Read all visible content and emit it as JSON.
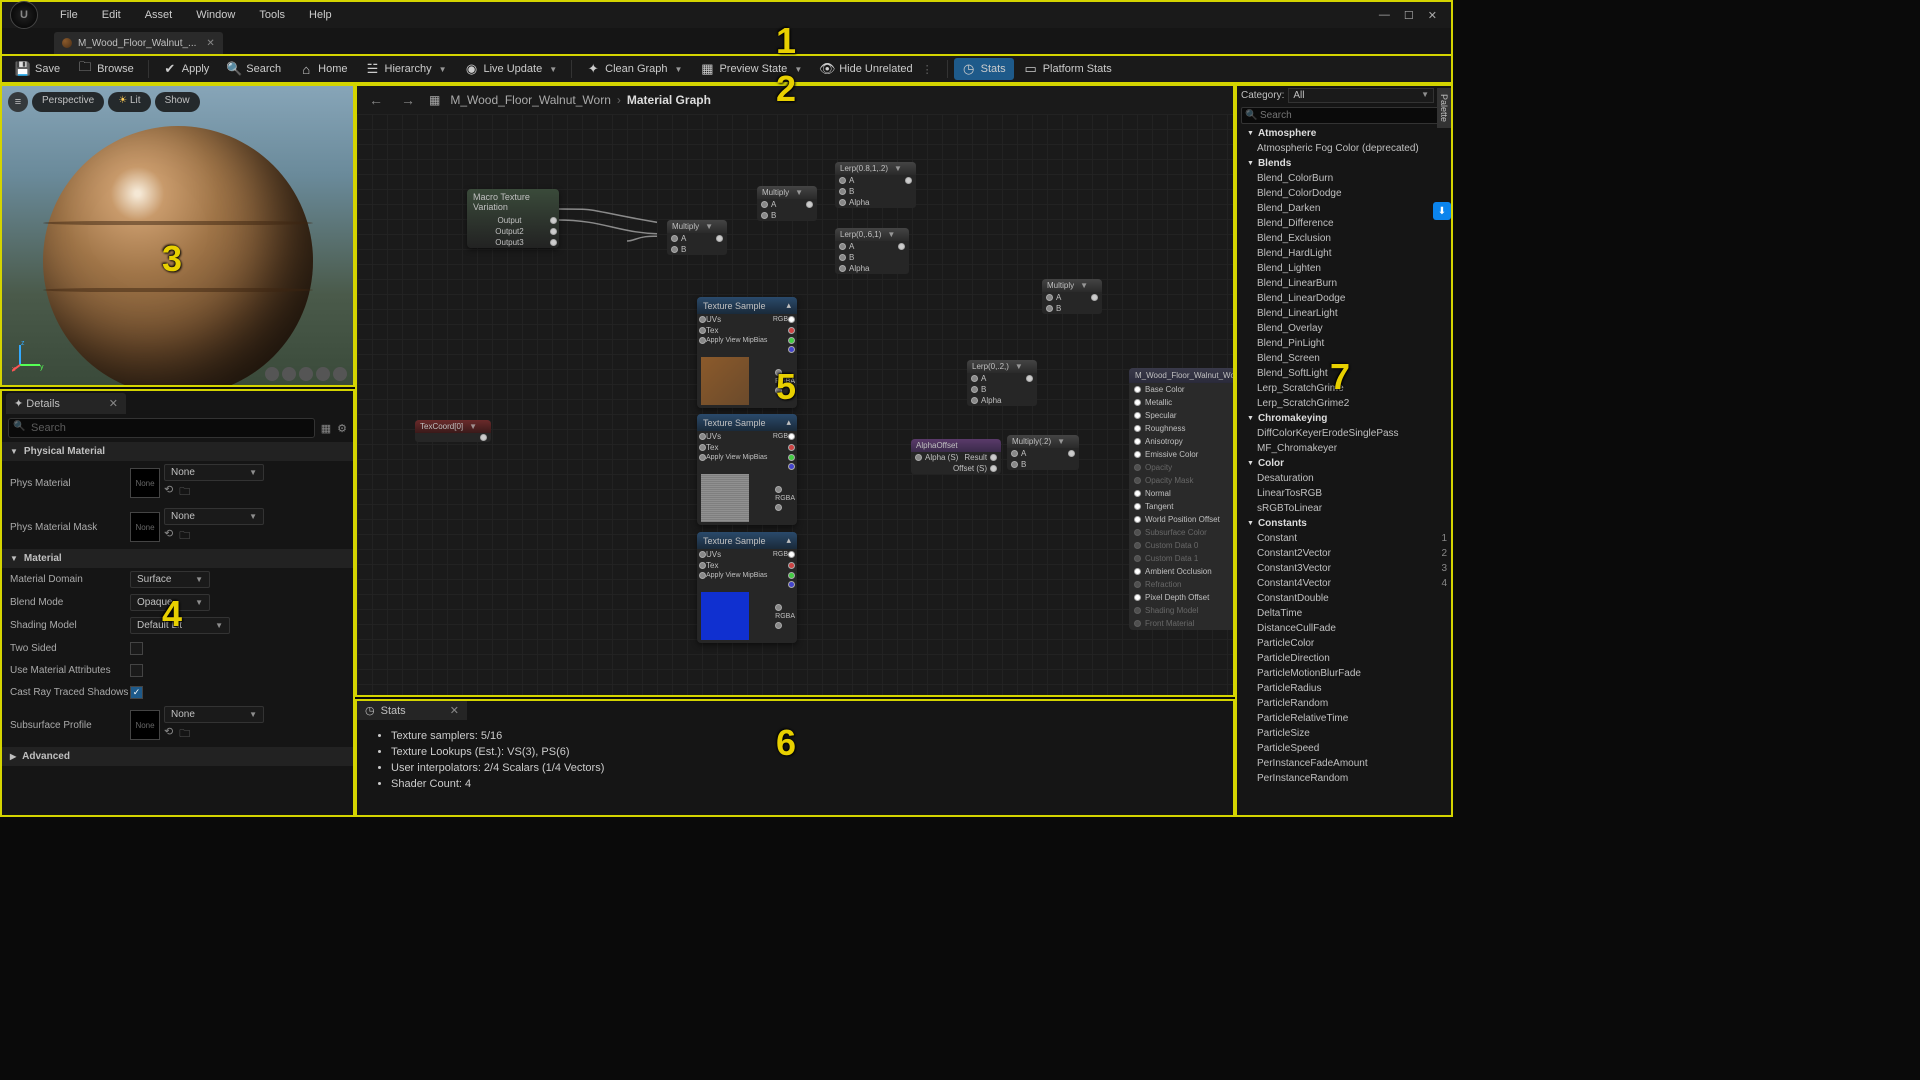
{
  "menubar": {
    "items": [
      "File",
      "Edit",
      "Asset",
      "Window",
      "Tools",
      "Help"
    ]
  },
  "tab": {
    "label": "M_Wood_Floor_Walnut_..."
  },
  "toolbar": {
    "save": "Save",
    "browse": "Browse",
    "apply": "Apply",
    "search": "Search",
    "home": "Home",
    "hierarchy": "Hierarchy",
    "live_update": "Live Update",
    "clean_graph": "Clean Graph",
    "preview_state": "Preview State",
    "hide_unrelated": "Hide Unrelated",
    "stats": "Stats",
    "platform_stats": "Platform Stats"
  },
  "viewport": {
    "perspective": "Perspective",
    "lit": "Lit",
    "show": "Show"
  },
  "details": {
    "tab_label": "Details",
    "search_placeholder": "Search",
    "sections": {
      "physical_material": "Physical Material",
      "material": "Material",
      "advanced": "Advanced"
    },
    "phys_material": {
      "label": "Phys Material",
      "thumb": "None",
      "dd": "None"
    },
    "phys_material_mask": {
      "label": "Phys Material Mask",
      "thumb": "None",
      "dd": "None"
    },
    "material_domain": {
      "label": "Material Domain",
      "value": "Surface"
    },
    "blend_mode": {
      "label": "Blend Mode",
      "value": "Opaque"
    },
    "shading_model": {
      "label": "Shading Model",
      "value": "Default Lit"
    },
    "two_sided": {
      "label": "Two Sided"
    },
    "use_material_attributes": {
      "label": "Use Material Attributes"
    },
    "cast_ray_traced": {
      "label": "Cast Ray Traced Shadows",
      "checked": true
    },
    "subsurface_profile": {
      "label": "Subsurface Profile",
      "thumb": "None",
      "dd": "None"
    }
  },
  "graph": {
    "breadcrumb_asset": "M_Wood_Floor_Walnut_Worn",
    "breadcrumb_current": "Material Graph",
    "nodes": {
      "macro": {
        "title": "Macro Texture Variation",
        "outputs": [
          "Output",
          "Output2",
          "Output3"
        ]
      },
      "multiply1": "Multiply",
      "multiply2": "Multiply",
      "multiply3": "Multiply",
      "multiply4": "Multiply(.2)",
      "lerp1": "Lerp(0.8,1,.2)",
      "lerp2": "Lerp(0,.6,1)",
      "lerp3": "Lerp(0,.2,)",
      "texcoord": "TexCoord[0]",
      "alpha_offset": "AlphaOffset",
      "ts1": "Texture Sample",
      "ts2": "Texture Sample",
      "ts3": "Texture Sample",
      "ts_pins": [
        "UVs",
        "Tex",
        "Apply View MipBias"
      ],
      "ts_outs": [
        "RGB",
        "R",
        "G",
        "B",
        "A",
        "RGBA"
      ],
      "lerp_pins": [
        "A",
        "B",
        "Alpha"
      ],
      "ao_pins": {
        "in": "Alpha (S)",
        "out1": "Result",
        "out2": "Offset (S)"
      }
    },
    "result": {
      "title": "M_Wood_Floor_Walnut_Worn",
      "pins": [
        {
          "label": "Base Color",
          "active": true
        },
        {
          "label": "Metallic",
          "active": true
        },
        {
          "label": "Specular",
          "active": true
        },
        {
          "label": "Roughness",
          "active": true
        },
        {
          "label": "Anisotropy",
          "active": true
        },
        {
          "label": "Emissive Color",
          "active": true
        },
        {
          "label": "Opacity",
          "active": false
        },
        {
          "label": "Opacity Mask",
          "active": false
        },
        {
          "label": "Normal",
          "active": true
        },
        {
          "label": "Tangent",
          "active": true
        },
        {
          "label": "World Position Offset",
          "active": true
        },
        {
          "label": "Subsurface Color",
          "active": false
        },
        {
          "label": "Custom Data 0",
          "active": false
        },
        {
          "label": "Custom Data 1",
          "active": false
        },
        {
          "label": "Ambient Occlusion",
          "active": true
        },
        {
          "label": "Refraction",
          "active": false
        },
        {
          "label": "Pixel Depth Offset",
          "active": true
        },
        {
          "label": "Shading Model",
          "active": false
        },
        {
          "label": "Front Material",
          "active": false
        }
      ]
    }
  },
  "stats": {
    "tab_label": "Stats",
    "lines": [
      "Texture samplers: 5/16",
      "Texture Lookups (Est.): VS(3), PS(6)",
      "User interpolators: 2/4 Scalars (1/4 Vectors)",
      "Shader Count: 4"
    ]
  },
  "palette": {
    "category_label": "Category:",
    "category_value": "All",
    "search_placeholder": "Search",
    "tab_label": "Palette",
    "groups": [
      {
        "name": "Atmosphere",
        "items": [
          {
            "label": "Atmospheric Fog Color (deprecated)"
          }
        ]
      },
      {
        "name": "Blends",
        "items": [
          {
            "label": "Blend_ColorBurn"
          },
          {
            "label": "Blend_ColorDodge"
          },
          {
            "label": "Blend_Darken"
          },
          {
            "label": "Blend_Difference"
          },
          {
            "label": "Blend_Exclusion"
          },
          {
            "label": "Blend_HardLight"
          },
          {
            "label": "Blend_Lighten"
          },
          {
            "label": "Blend_LinearBurn"
          },
          {
            "label": "Blend_LinearDodge"
          },
          {
            "label": "Blend_LinearLight"
          },
          {
            "label": "Blend_Overlay"
          },
          {
            "label": "Blend_PinLight"
          },
          {
            "label": "Blend_Screen"
          },
          {
            "label": "Blend_SoftLight"
          },
          {
            "label": "Lerp_ScratchGrime"
          },
          {
            "label": "Lerp_ScratchGrime2"
          }
        ]
      },
      {
        "name": "Chromakeying",
        "items": [
          {
            "label": "DiffColorKeyerErodeSinglePass"
          },
          {
            "label": "MF_Chromakeyer"
          }
        ]
      },
      {
        "name": "Color",
        "items": [
          {
            "label": "Desaturation"
          },
          {
            "label": "LinearTosRGB"
          },
          {
            "label": "sRGBToLinear"
          }
        ]
      },
      {
        "name": "Constants",
        "items": [
          {
            "label": "Constant",
            "shortcut": "1"
          },
          {
            "label": "Constant2Vector",
            "shortcut": "2"
          },
          {
            "label": "Constant3Vector",
            "shortcut": "3"
          },
          {
            "label": "Constant4Vector",
            "shortcut": "4"
          },
          {
            "label": "ConstantDouble"
          },
          {
            "label": "DeltaTime"
          },
          {
            "label": "DistanceCullFade"
          },
          {
            "label": "ParticleColor"
          },
          {
            "label": "ParticleDirection"
          },
          {
            "label": "ParticleMotionBlurFade"
          },
          {
            "label": "ParticleRadius"
          },
          {
            "label": "ParticleRandom"
          },
          {
            "label": "ParticleRelativeTime"
          },
          {
            "label": "ParticleSize"
          },
          {
            "label": "ParticleSpeed"
          },
          {
            "label": "PerInstanceFadeAmount"
          },
          {
            "label": "PerInstanceRandom"
          }
        ]
      }
    ]
  },
  "callouts": {
    "1": "1",
    "2": "2",
    "3": "3",
    "4": "4",
    "5": "5",
    "6": "6",
    "7": "7"
  }
}
